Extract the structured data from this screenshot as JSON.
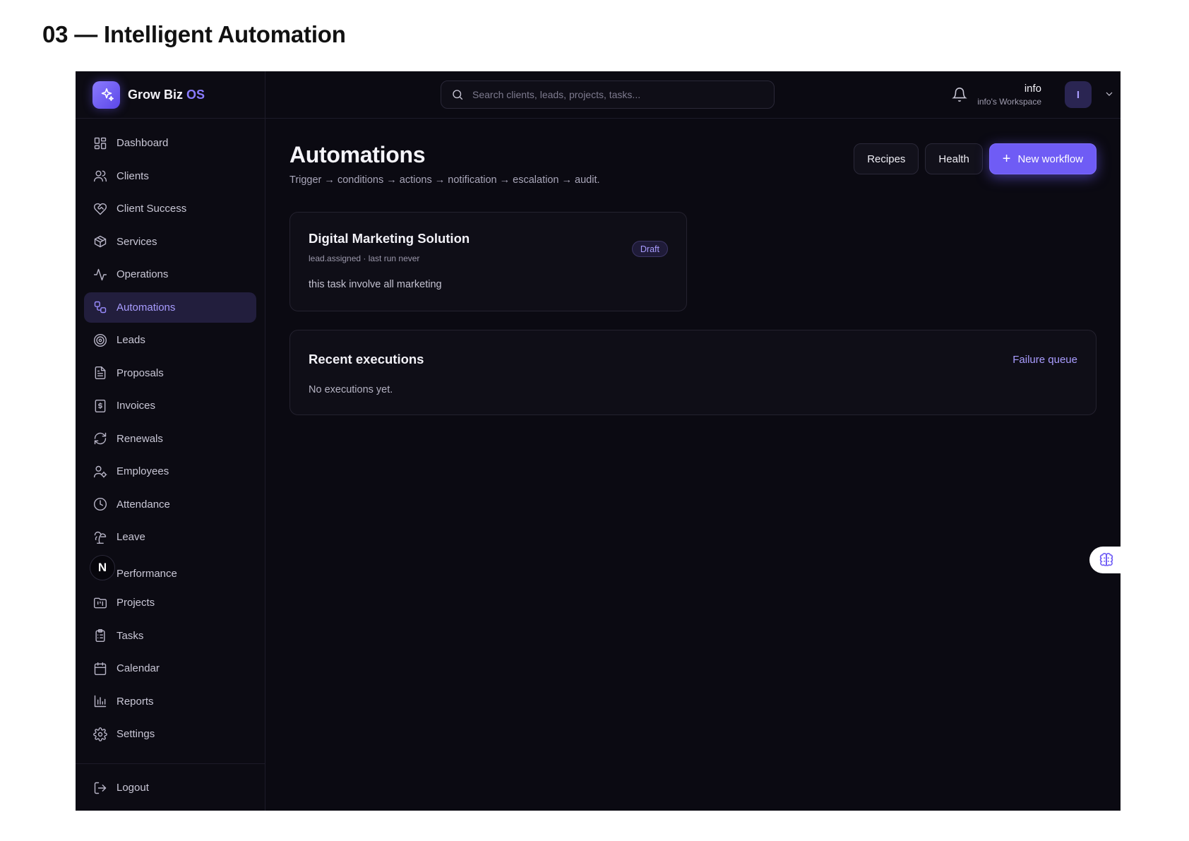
{
  "page_heading": "03 — Intelligent Automation",
  "brand": {
    "name": "Grow Biz",
    "suffix": "OS",
    "logo_icon": "sparkles-icon"
  },
  "sidebar": {
    "items": [
      {
        "label": "Dashboard",
        "icon": "grid-icon"
      },
      {
        "label": "Clients",
        "icon": "users-icon"
      },
      {
        "label": "Client Success",
        "icon": "heart-handshake-icon"
      },
      {
        "label": "Services",
        "icon": "package-icon"
      },
      {
        "label": "Operations",
        "icon": "activity-icon"
      },
      {
        "label": "Automations",
        "icon": "workflow-icon",
        "active": true
      },
      {
        "label": "Leads",
        "icon": "target-icon"
      },
      {
        "label": "Proposals",
        "icon": "file-text-icon"
      },
      {
        "label": "Invoices",
        "icon": "receipt-dollar-icon"
      },
      {
        "label": "Renewals",
        "icon": "refresh-icon"
      },
      {
        "label": "Employees",
        "icon": "user-cog-icon"
      },
      {
        "label": "Attendance",
        "icon": "clock-icon"
      },
      {
        "label": "Leave",
        "icon": "palm-tree-icon"
      },
      {
        "label": "Performance",
        "icon": "n-badge-icon",
        "badge": "N"
      },
      {
        "label": "Projects",
        "icon": "folder-kanban-icon"
      },
      {
        "label": "Tasks",
        "icon": "clipboard-list-icon"
      },
      {
        "label": "Calendar",
        "icon": "calendar-icon"
      },
      {
        "label": "Reports",
        "icon": "bar-chart-icon"
      },
      {
        "label": "Settings",
        "icon": "settings-icon"
      }
    ],
    "logout": {
      "label": "Logout",
      "icon": "log-out-icon"
    }
  },
  "topbar": {
    "search_placeholder": "Search clients, leads, projects, tasks...",
    "user_name": "info",
    "workspace": "info's Workspace",
    "avatar_initial": "I"
  },
  "main": {
    "title": "Automations",
    "subtitle": "Trigger → conditions → actions → notification → escalation → audit.",
    "buttons": {
      "recipes": "Recipes",
      "health": "Health",
      "new_workflow": "New workflow"
    },
    "workflow_card": {
      "title": "Digital Marketing Solution",
      "meta": "lead.assigned · last run never",
      "description": "this task involve all marketing",
      "status": "Draft"
    },
    "executions": {
      "title": "Recent executions",
      "link": "Failure queue",
      "empty": "No executions yet."
    }
  },
  "colors": {
    "accent": "#6f5cf5",
    "accent_text": "#a99cff",
    "background": "#0b0a12"
  }
}
